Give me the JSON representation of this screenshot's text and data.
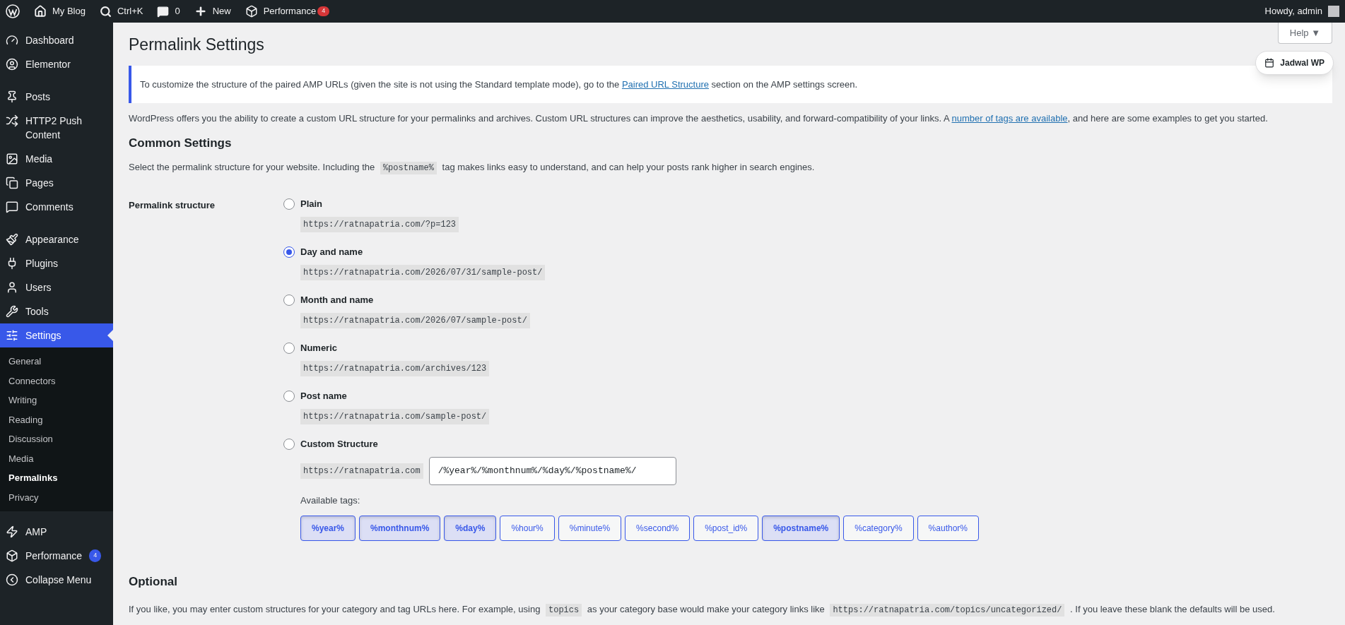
{
  "admin_bar": {
    "items": [
      {
        "kind": "logo"
      },
      {
        "kind": "home",
        "label": "My Blog"
      },
      {
        "kind": "search",
        "label": "Ctrl+K"
      },
      {
        "kind": "comments",
        "label": "0"
      },
      {
        "kind": "new",
        "label": "New"
      },
      {
        "kind": "performance",
        "label": "Performance",
        "badge": "4"
      }
    ],
    "greeting": "Howdy, admin"
  },
  "sidebar": {
    "groups": [
      [
        {
          "label": "Dashboard",
          "selected": false
        },
        {
          "label": "Elementor",
          "selected": false
        }
      ],
      [
        {
          "label": "Posts",
          "selected": false
        },
        {
          "label": "HTTP2 Push Content",
          "selected": false
        },
        {
          "label": "Media",
          "selected": false
        },
        {
          "label": "Pages",
          "selected": false
        },
        {
          "label": "Comments",
          "selected": false
        }
      ],
      [
        {
          "label": "Appearance",
          "selected": false
        },
        {
          "label": "Plugins",
          "selected": false
        },
        {
          "label": "Users",
          "selected": false
        },
        {
          "label": "Tools",
          "selected": false
        },
        {
          "label": "Settings",
          "selected": true,
          "children": [
            {
              "label": "General",
              "selected": false
            },
            {
              "label": "Connectors",
              "selected": false
            },
            {
              "label": "Writing",
              "selected": false
            },
            {
              "label": "Reading",
              "selected": false
            },
            {
              "label": "Discussion",
              "selected": false
            },
            {
              "label": "Media",
              "selected": false
            },
            {
              "label": "Permalinks",
              "selected": true
            },
            {
              "label": "Privacy",
              "selected": false
            }
          ]
        }
      ],
      [
        {
          "label": "AMP",
          "selected": false
        },
        {
          "label": "Performance",
          "selected": false,
          "badge": "4"
        },
        {
          "label": "Collapse Menu",
          "selected": false
        }
      ]
    ]
  },
  "help_button": "Help ▼",
  "floating_button": "Jadwal WP",
  "title": "Permalink Settings",
  "notice": [
    {
      "kind": "text",
      "text": "To customize the structure of the paired AMP URLs (given the site is not using the Standard template mode), go to the "
    },
    {
      "kind": "link",
      "text": "Paired URL Structure"
    },
    {
      "kind": "text",
      "text": " section on the AMP settings screen."
    }
  ],
  "intro": [
    {
      "kind": "text",
      "text": "WordPress offers you the ability to create a custom URL structure for your permalinks and archives. Custom URL structures can improve the aesthetics, usability, and forward-compatibility of your links. A "
    },
    {
      "kind": "link",
      "text": "number of tags are available"
    },
    {
      "kind": "text",
      "text": ", and here are some examples to get you started."
    }
  ],
  "common_heading": "Common Settings",
  "common_text": [
    {
      "kind": "text",
      "text": "Select the permalink structure for your website. Including the "
    },
    {
      "kind": "code",
      "text": "%postname%"
    },
    {
      "kind": "text",
      "text": " tag makes links easy to understand, and can help your posts rank higher in search engines."
    }
  ],
  "structure_label": "Permalink structure",
  "options": [
    {
      "label": "Plain",
      "example": "https://ratnapatria.com/?p=123",
      "selected": false
    },
    {
      "label": "Day and name",
      "example": "https://ratnapatria.com/2026/07/31/sample-post/",
      "selected": true
    },
    {
      "label": "Month and name",
      "example": "https://ratnapatria.com/2026/07/sample-post/",
      "selected": false
    },
    {
      "label": "Numeric",
      "example": "https://ratnapatria.com/archives/123",
      "selected": false
    },
    {
      "label": "Post name",
      "example": "https://ratnapatria.com/sample-post/",
      "selected": false
    }
  ],
  "custom": {
    "label": "Custom Structure",
    "selected": false,
    "prefix": "https://ratnapatria.com",
    "value": "/%year%/%monthnum%/%day%/%postname%/",
    "tags_label": "Available tags:",
    "tags": [
      {
        "label": "%year%",
        "selected": true
      },
      {
        "label": "%monthnum%",
        "selected": true
      },
      {
        "label": "%day%",
        "selected": true
      },
      {
        "label": "%hour%",
        "selected": false
      },
      {
        "label": "%minute%",
        "selected": false
      },
      {
        "label": "%second%",
        "selected": false
      },
      {
        "label": "%post_id%",
        "selected": false
      },
      {
        "label": "%postname%",
        "selected": true
      },
      {
        "label": "%category%",
        "selected": false
      },
      {
        "label": "%author%",
        "selected": false
      }
    ]
  },
  "optional_heading": "Optional",
  "optional_text": [
    {
      "kind": "text",
      "text": "If you like, you may enter custom structures for your category and tag URLs here. For example, using "
    },
    {
      "kind": "code",
      "text": "topics"
    },
    {
      "kind": "text",
      "text": " as your category base would make your category links like "
    },
    {
      "kind": "code",
      "text": "https://ratnapatria.com/topics/uncategorized/"
    },
    {
      "kind": "text",
      "text": " . If you leave these blank the defaults will be used."
    }
  ]
}
